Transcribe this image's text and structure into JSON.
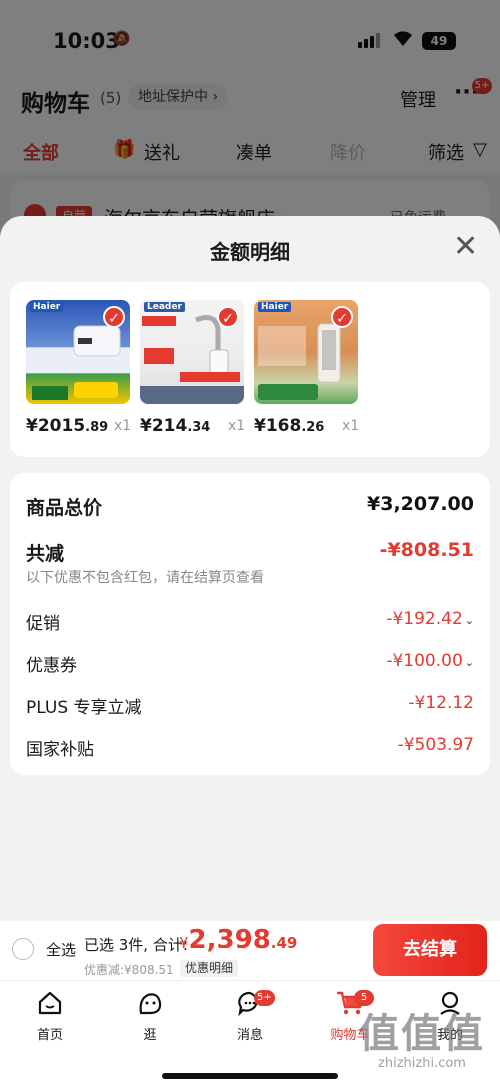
{
  "status_bar": {
    "time": "10:03",
    "battery": "49"
  },
  "cart_header": {
    "title": "购物车",
    "count": "(5)",
    "address_protection": "地址保护中 ›",
    "manage": "管理",
    "more_badge": "5+"
  },
  "cart_tabs": [
    {
      "label": "全部"
    },
    {
      "label": "送礼"
    },
    {
      "label": "凑单"
    },
    {
      "label": "降价"
    },
    {
      "label": "筛选"
    }
  ],
  "shop": {
    "tag": "自营",
    "name": "海尔京东自营旗舰店 ›",
    "shipping": "已免运费"
  },
  "sheet": {
    "title": "金额明细",
    "products": [
      {
        "brand": "Haier",
        "price_int": "¥2015",
        "price_dec": ".89",
        "qty": "x1",
        "image_theme": "water-heater"
      },
      {
        "brand": "Leader",
        "price_int": "¥214",
        "price_dec": ".34",
        "qty": "x1",
        "image_theme": "faucet-heater"
      },
      {
        "brand": "Haier",
        "price_int": "¥168",
        "price_dec": ".26",
        "qty": "x1",
        "image_theme": "tower-heater"
      }
    ],
    "details": {
      "total_label": "商品总价",
      "total_value": "¥3,207.00",
      "reduction_label": "共减",
      "reduction_value": "-¥808.51",
      "reduction_note": "以下优惠不包含红包，请在结算页查看",
      "rows": [
        {
          "label": "促销",
          "value": "-¥192.42"
        },
        {
          "label": "优惠券",
          "value": "-¥100.00"
        },
        {
          "label": "PLUS 专享立减",
          "value": "-¥12.12"
        },
        {
          "label": "国家补贴",
          "value": "-¥503.97"
        }
      ]
    }
  },
  "checkout": {
    "select_all": "全选",
    "summary": "已选 3件, 合计:",
    "currency": "¥",
    "total_int": "2,398",
    "total_dec": ".49",
    "discount": "优惠减:¥808.51",
    "detail_link": "优惠明细",
    "button": "去结算"
  },
  "tabbar": [
    {
      "label": "首页",
      "icon": "home-icon"
    },
    {
      "label": "逛",
      "icon": "stroll-icon"
    },
    {
      "label": "消息",
      "icon": "message-icon",
      "badge": "5+"
    },
    {
      "label": "购物车",
      "icon": "cart-icon",
      "badge": "5"
    },
    {
      "label": "我的",
      "icon": "profile-icon"
    }
  ],
  "watermark": {
    "logo": "值值值",
    "url": "zhizhizhi.com"
  },
  "colors": {
    "accent": "#e53a2f",
    "sheet_bg": "#f2f2f2"
  }
}
